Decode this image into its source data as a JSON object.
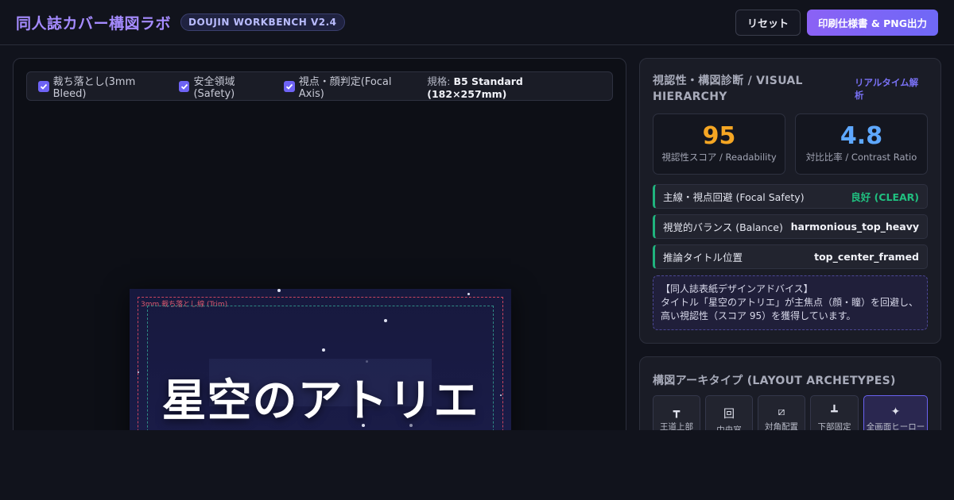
{
  "header": {
    "title": "同人誌カバー構図ラボ",
    "version": "DOUJIN WORKBENCH V2.4",
    "reset_label": "リセット",
    "export_label": "印刷仕様書 & PNG出力"
  },
  "toolbar": {
    "bleed_label": "裁ち落とし(3mm Bleed)",
    "safety_label": "安全領域(Safety)",
    "focal_label": "視点・顔判定(Focal Axis)",
    "spec_prefix": "規格:",
    "spec_value": "B5 Standard (182×257mm)"
  },
  "cover": {
    "title": "星空のアトリエ",
    "bleed_guide_label": "3mm 裁ち落とし線 (Trim)"
  },
  "diagnosis": {
    "title": "視認性・構図診断 / VISUAL HIERARCHY",
    "realtime_label": "リアルタイム解析",
    "readability_value": "95",
    "readability_label": "視認性スコア / Readability",
    "contrast_value": "4.8",
    "contrast_label": "対比比率 / Contrast Ratio",
    "rows": [
      {
        "label": "主線・視点回避 (Focal Safety)",
        "value": "良好 (CLEAR)"
      },
      {
        "label": "視覚的バランス (Balance)",
        "value": "harmonious_top_heavy"
      },
      {
        "label": "推論タイトル位置",
        "value": "top_center_framed"
      }
    ],
    "advice_title": "【同人誌表紙デザインアドバイス】",
    "advice_body": "タイトル「星空のアトリエ」が主焦点（顔・瞳）を回避し、高い視認性（スコア 95）を獲得しています。"
  },
  "archetypes": {
    "title": "構図アーキタイプ (LAYOUT ARCHETYPES)",
    "items": [
      {
        "icon": "T-top-icon",
        "glyph": "┳",
        "label": "王道上部"
      },
      {
        "icon": "center-window-icon",
        "glyph": "回",
        "label": "中央窓"
      },
      {
        "icon": "diagonal-icon",
        "glyph": "⧄",
        "label": "対角配置"
      },
      {
        "icon": "bottom-fixed-icon",
        "glyph": "┻",
        "label": "下部固定"
      },
      {
        "icon": "sparkle-icon",
        "glyph": "✦",
        "label": "全画面ヒーロー"
      }
    ]
  },
  "colors": {
    "accent": "#6e63f5",
    "score": "#f5a623",
    "contrast": "#5ea8ff",
    "good": "#20b37e"
  }
}
